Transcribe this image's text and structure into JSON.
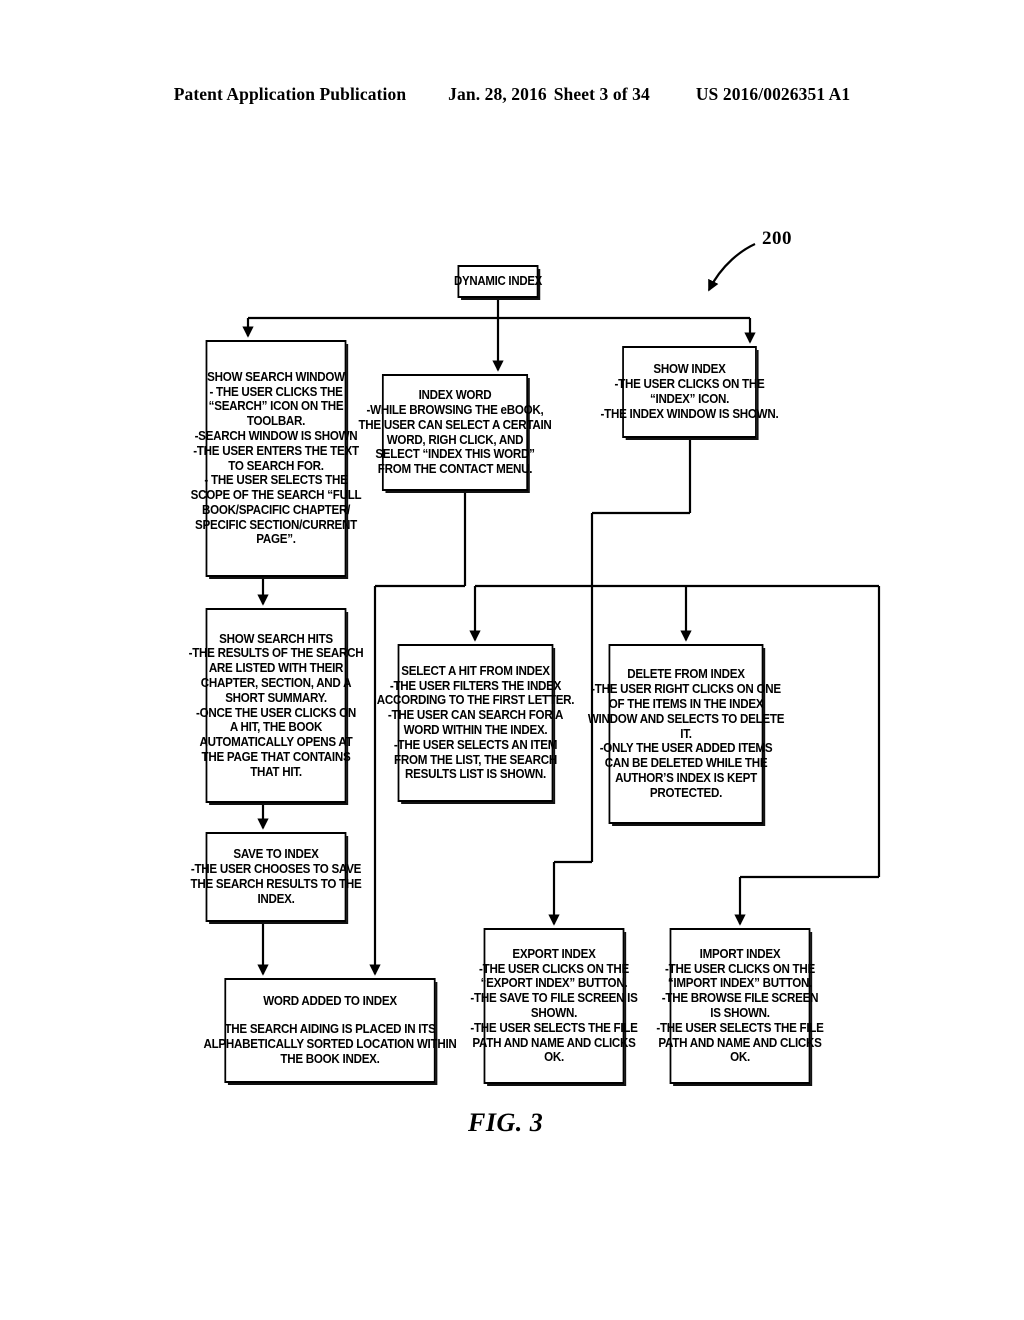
{
  "header": {
    "publication": "Patent Application Publication",
    "date": "Jan. 28, 2016",
    "sheet": "Sheet 3 of 34",
    "number": "US 2016/0026351 A1"
  },
  "figure": {
    "caption": "FIG. 3",
    "reference_numeral": "200",
    "type": "flowchart",
    "colors": {
      "line": "#000000",
      "background": "#ffffff",
      "text": "#000000"
    }
  },
  "nodes": {
    "root": {
      "id": "dynamic-index",
      "lines": [
        "DYNAMIC INDEX"
      ]
    },
    "show_search_window": {
      "id": "show-search-window",
      "lines": [
        "SHOW SEARCH WINDOW",
        "- THE USER CLICKS THE",
        "“SEARCH” ICON ON THE",
        "TOOLBAR.",
        "-SEARCH WINDOW IS SHOWN",
        "-THE USER ENTERS THE TEXT",
        "TO SEARCH FOR.",
        "- THE USER SELECTS THE",
        "SCOPE OF THE SEARCH “FULL",
        "BOOK/SPACIFIC CHAPTER/",
        "SPECIFIC SECTION/CURRENT",
        "PAGE”."
      ]
    },
    "index_word": {
      "id": "index-word",
      "lines": [
        "INDEX WORD",
        "-WHILE BROWSING THE eBOOK,",
        "THE USER CAN SELECT A CERTAIN",
        "WORD, RIGH CLICK, AND",
        "SELECT “INDEX THIS WORD”",
        "FROM THE CONTACT MENU."
      ]
    },
    "show_index": {
      "id": "show-index",
      "lines": [
        "SHOW INDEX",
        "-THE USER CLICKS ON THE",
        "“INDEX” ICON.",
        "-THE INDEX WINDOW IS SHOWN."
      ]
    },
    "show_search_hits": {
      "id": "show-search-hits",
      "lines": [
        "SHOW SEARCH HITS",
        "-THE RESULTS OF THE SEARCH",
        "ARE LISTED WITH THEIR",
        "CHAPTER, SECTION, AND A",
        "SHORT SUMMARY.",
        "-ONCE THE USER CLICKS ON",
        "A HIT, THE BOOK",
        "AUTOMATICALLY OPENS AT",
        "THE PAGE THAT CONTAINS",
        "THAT HIT."
      ]
    },
    "select_a_hit": {
      "id": "select-a-hit-from-index",
      "lines": [
        "SELECT A HIT FROM INDEX",
        "-THE USER FILTERS THE INDEX",
        "ACCORDING TO THE FIRST LETTER.",
        "-THE USER CAN SEARCH FOR A",
        "WORD WITHIN THE INDEX.",
        "-THE USER SELECTS AN ITEM",
        "FROM THE LIST, THE SEARCH",
        "RESULTS LIST IS SHOWN."
      ]
    },
    "delete_from_index": {
      "id": "delete-from-index",
      "lines": [
        "DELETE FROM INDEX",
        "-THE USER RIGHT CLICKS ON ONE",
        "OF THE ITEMS IN THE INDEX",
        "WINDOW AND SELECTS TO DELETE",
        "IT.",
        "-ONLY THE USER ADDED ITEMS",
        "CAN BE DELETED WHILE THE",
        "AUTHOR’S INDEX IS KEPT",
        "PROTECTED."
      ]
    },
    "save_to_index": {
      "id": "save-to-index",
      "lines": [
        "SAVE TO INDEX",
        "-THE USER CHOOSES TO SAVE",
        "THE SEARCH RESULTS TO THE",
        "INDEX."
      ]
    },
    "word_added": {
      "id": "word-added-to-index",
      "title": "WORD ADDED TO INDEX",
      "lines": [
        "THE SEARCH AIDING IS PLACED IN ITS",
        "ALPHABETICALLY SORTED LOCATION WITHIN",
        "THE BOOK INDEX."
      ]
    },
    "export_index": {
      "id": "export-index",
      "lines": [
        "EXPORT INDEX",
        "-THE USER CLICKS ON THE",
        "“EXPORT INDEX” BUTTON.",
        "-THE SAVE TO FILE SCREEN IS",
        "SHOWN.",
        "-THE USER SELECTS THE FILE",
        "PATH AND NAME AND CLICKS",
        "OK."
      ]
    },
    "import_index": {
      "id": "import-index",
      "lines": [
        "IMPORT INDEX",
        "-THE USER CLICKS ON THE",
        "“IMPORT INDEX” BUTTON.",
        "-THE BROWSE FILE SCREEN",
        "IS SHOWN.",
        "-THE USER SELECTS THE FILE",
        "PATH AND NAME AND CLICKS",
        "OK."
      ]
    }
  },
  "edges": [
    {
      "from": "dynamic-index",
      "to": "show-search-window"
    },
    {
      "from": "dynamic-index",
      "to": "index-word"
    },
    {
      "from": "dynamic-index",
      "to": "show-index"
    },
    {
      "from": "show-search-window",
      "to": "show-search-hits"
    },
    {
      "from": "show-search-hits",
      "to": "save-to-index"
    },
    {
      "from": "save-to-index",
      "to": "word-added-to-index"
    },
    {
      "from": "index-word",
      "to": "word-added-to-index"
    },
    {
      "from": "index-word",
      "to": "select-a-hit-from-index"
    },
    {
      "from": "show-index",
      "to": "select-a-hit-from-index"
    },
    {
      "from": "show-index",
      "to": "delete-from-index"
    },
    {
      "from": "show-index",
      "to": "export-index"
    },
    {
      "from": "show-index",
      "to": "import-index"
    }
  ]
}
